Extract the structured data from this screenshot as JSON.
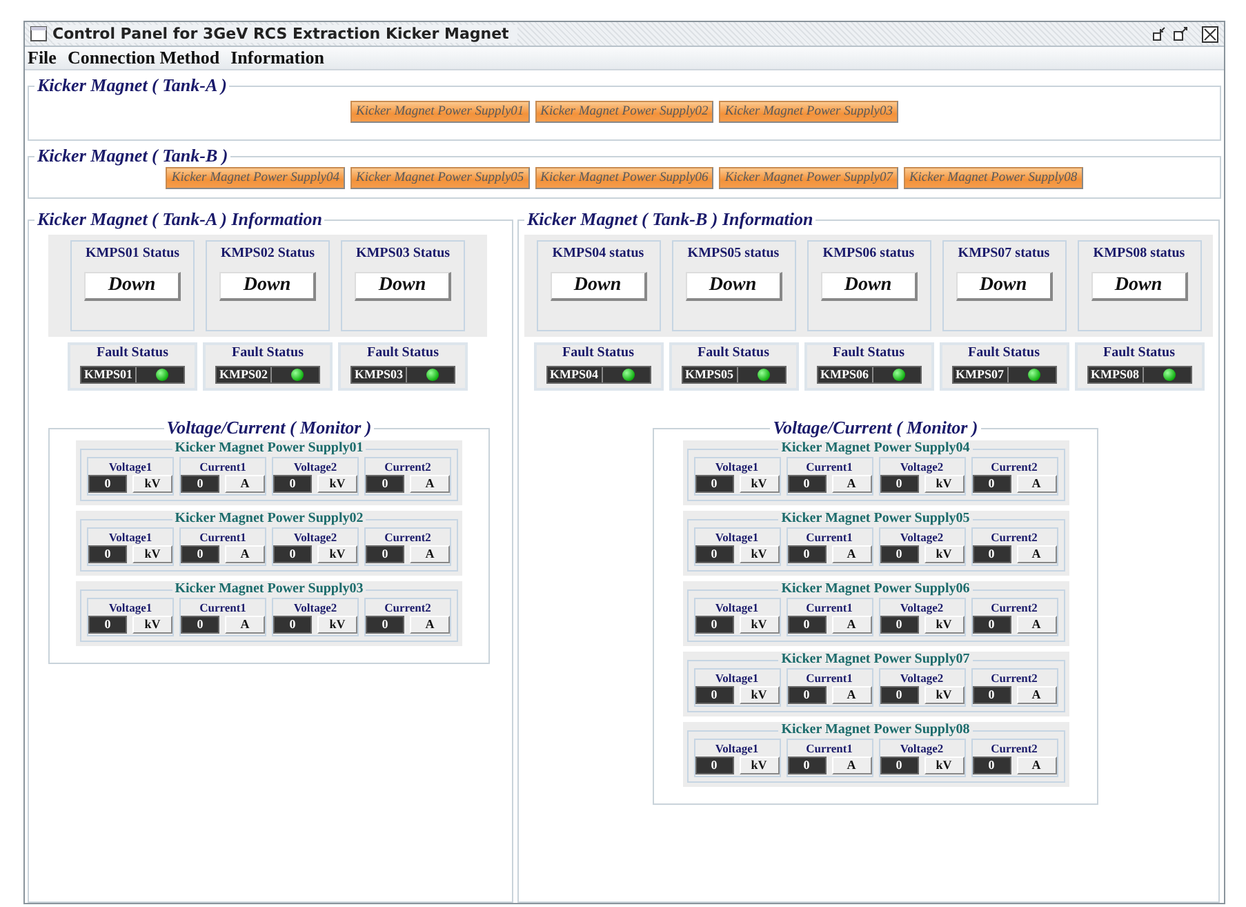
{
  "window": {
    "title": "Control Panel for 3GeV RCS Extraction Kicker Magnet"
  },
  "menu": [
    "File",
    "Connection Method",
    "Information"
  ],
  "tanks": [
    {
      "title": "Kicker Magnet ( Tank-A )",
      "buttons": [
        "Kicker Magnet Power Supply01",
        "Kicker Magnet Power Supply02",
        "Kicker Magnet Power Supply03"
      ]
    },
    {
      "title": "Kicker Magnet ( Tank-B )",
      "buttons": [
        "Kicker Magnet Power Supply04",
        "Kicker Magnet Power Supply05",
        "Kicker Magnet Power Supply06",
        "Kicker Magnet Power Supply07",
        "Kicker Magnet Power Supply08"
      ]
    }
  ],
  "panels": [
    {
      "title": "Kicker Magnet ( Tank-A ) Information",
      "status": [
        {
          "label": "KMPS01 Status",
          "value": "Down"
        },
        {
          "label": "KMPS02 Status",
          "value": "Down"
        },
        {
          "label": "KMPS03 Status",
          "value": "Down"
        }
      ],
      "faults": [
        {
          "label": "Fault Status",
          "name": "KMPS01",
          "alarm": false
        },
        {
          "label": "Fault Status",
          "name": "KMPS02",
          "alarm": false
        },
        {
          "label": "Fault Status",
          "name": "KMPS03",
          "alarm": false
        }
      ],
      "monitor": {
        "title": "Voltage/Current ( Monitor )",
        "groups": [
          {
            "title": "Kicker Magnet Power Supply01",
            "readings": [
              {
                "label": "Voltage1",
                "value": "0",
                "unit": "kV"
              },
              {
                "label": "Current1",
                "value": "0",
                "unit": "A"
              },
              {
                "label": "Voltage2",
                "value": "0",
                "unit": "kV"
              },
              {
                "label": "Current2",
                "value": "0",
                "unit": "A"
              }
            ]
          },
          {
            "title": "Kicker Magnet Power Supply02",
            "readings": [
              {
                "label": "Voltage1",
                "value": "0",
                "unit": "kV"
              },
              {
                "label": "Current1",
                "value": "0",
                "unit": "A"
              },
              {
                "label": "Voltage2",
                "value": "0",
                "unit": "kV"
              },
              {
                "label": "Current2",
                "value": "0",
                "unit": "A"
              }
            ]
          },
          {
            "title": "Kicker Magnet Power Supply03",
            "readings": [
              {
                "label": "Voltage1",
                "value": "0",
                "unit": "kV"
              },
              {
                "label": "Current1",
                "value": "0",
                "unit": "A"
              },
              {
                "label": "Voltage2",
                "value": "0",
                "unit": "kV"
              },
              {
                "label": "Current2",
                "value": "0",
                "unit": "A"
              }
            ]
          }
        ]
      }
    },
    {
      "title": "Kicker Magnet ( Tank-B ) Information",
      "status": [
        {
          "label": "KMPS04 status",
          "value": "Down"
        },
        {
          "label": "KMPS05 status",
          "value": "Down"
        },
        {
          "label": "KMPS06 status",
          "value": "Down"
        },
        {
          "label": "KMPS07 status",
          "value": "Down"
        },
        {
          "label": "KMPS08 status",
          "value": "Down"
        }
      ],
      "faults": [
        {
          "label": "Fault Status",
          "name": "KMPS04",
          "alarm": false
        },
        {
          "label": "Fault Status",
          "name": "KMPS05",
          "alarm": false
        },
        {
          "label": "Fault Status",
          "name": "KMPS06",
          "alarm": false
        },
        {
          "label": "Fault Status",
          "name": "KMPS07",
          "alarm": false
        },
        {
          "label": "Fault Status",
          "name": "KMPS08",
          "alarm": false
        }
      ],
      "monitor": {
        "title": "Voltage/Current ( Monitor )",
        "groups": [
          {
            "title": "Kicker Magnet Power Supply04",
            "readings": [
              {
                "label": "Voltage1",
                "value": "0",
                "unit": "kV"
              },
              {
                "label": "Current1",
                "value": "0",
                "unit": "A"
              },
              {
                "label": "Voltage2",
                "value": "0",
                "unit": "kV"
              },
              {
                "label": "Current2",
                "value": "0",
                "unit": "A"
              }
            ]
          },
          {
            "title": "Kicker Magnet Power Supply05",
            "readings": [
              {
                "label": "Voltage1",
                "value": "0",
                "unit": "kV"
              },
              {
                "label": "Current1",
                "value": "0",
                "unit": "A"
              },
              {
                "label": "Voltage2",
                "value": "0",
                "unit": "kV"
              },
              {
                "label": "Current2",
                "value": "0",
                "unit": "A"
              }
            ]
          },
          {
            "title": "Kicker Magnet Power Supply06",
            "readings": [
              {
                "label": "Voltage1",
                "value": "0",
                "unit": "kV"
              },
              {
                "label": "Current1",
                "value": "0",
                "unit": "A"
              },
              {
                "label": "Voltage2",
                "value": "0",
                "unit": "kV"
              },
              {
                "label": "Current2",
                "value": "0",
                "unit": "A"
              }
            ]
          },
          {
            "title": "Kicker Magnet Power Supply07",
            "readings": [
              {
                "label": "Voltage1",
                "value": "0",
                "unit": "kV"
              },
              {
                "label": "Current1",
                "value": "0",
                "unit": "A"
              },
              {
                "label": "Voltage2",
                "value": "0",
                "unit": "kV"
              },
              {
                "label": "Current2",
                "value": "0",
                "unit": "A"
              }
            ]
          },
          {
            "title": "Kicker Magnet Power Supply08",
            "readings": [
              {
                "label": "Voltage1",
                "value": "0",
                "unit": "kV"
              },
              {
                "label": "Current1",
                "value": "0",
                "unit": "A"
              },
              {
                "label": "Voltage2",
                "value": "0",
                "unit": "kV"
              },
              {
                "label": "Current2",
                "value": "0",
                "unit": "A"
              }
            ]
          }
        ]
      }
    }
  ]
}
